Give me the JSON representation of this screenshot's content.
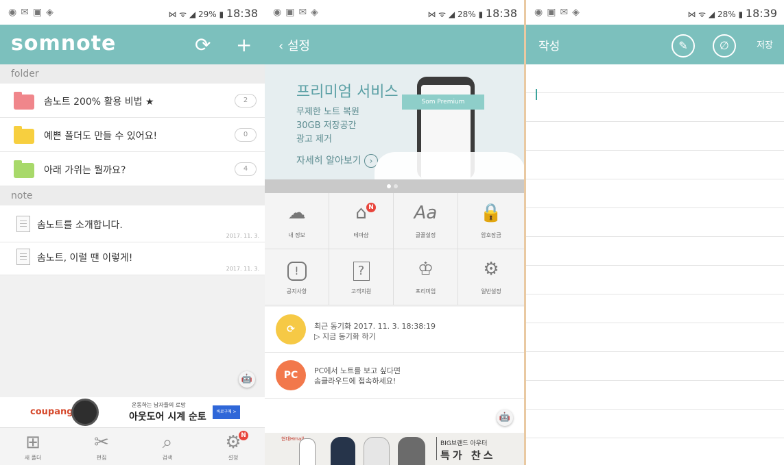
{
  "colors": {
    "teal": "#7cc0bd",
    "badge_red": "#e8453c",
    "folder_red": "#f0868b",
    "folder_yellow": "#f7cf3f",
    "folder_green": "#a8d96a",
    "sync_yellow": "#f6c945",
    "pc_orange": "#f2784b"
  },
  "statusbars": [
    {
      "battery": "29%",
      "time": "18:38"
    },
    {
      "battery": "28%",
      "time": "18:38"
    },
    {
      "battery": "28%",
      "time": "18:39"
    }
  ],
  "list_screen": {
    "logo": "somnote",
    "folder_header": "folder",
    "folders": [
      {
        "name": "솜노트 200% 활용 비법 ★",
        "count": "2"
      },
      {
        "name": "예쁜 폴더도 만들 수 있어요!",
        "count": "0"
      },
      {
        "name": "아래 가위는 뭘까요?",
        "count": "4"
      }
    ],
    "note_header": "note",
    "notes": [
      {
        "title": "솜노트를 소개합니다.",
        "date": "2017. 11. 3."
      },
      {
        "title": "솜노트, 이럴 땐 이렇게!",
        "date": "2017. 11. 3."
      }
    ],
    "ad": {
      "brand": "coupang",
      "small": "운동하는 남자들의 로망",
      "big": "아웃도어 시계 순토",
      "button": "바로구매 >"
    },
    "bottom_nav": [
      {
        "label": "새 폴더",
        "icon": "new-folder-icon"
      },
      {
        "label": "편집",
        "icon": "scissors-icon"
      },
      {
        "label": "검색",
        "icon": "search-icon"
      },
      {
        "label": "설정",
        "icon": "gear-icon",
        "badge": "N"
      }
    ]
  },
  "settings_screen": {
    "back_title": "설정",
    "banner": {
      "title": "프리미엄 서비스",
      "line1": "무제한 노트 복원",
      "line2": "30GB 저장공간",
      "line3": "광고 제거",
      "more": "자세히 알아보기",
      "ribbon": "Som Premium"
    },
    "grid": [
      {
        "label": "내 정보",
        "icon": "cloud-icon"
      },
      {
        "label": "테마샵",
        "icon": "shop-icon",
        "badge": "N"
      },
      {
        "label": "글꼴설정",
        "icon": "font-icon",
        "glyph": "Aa"
      },
      {
        "label": "암호잠금",
        "icon": "lock-icon"
      },
      {
        "label": "공지사항",
        "icon": "notice-icon",
        "glyph": "!"
      },
      {
        "label": "고객지원",
        "icon": "help-icon",
        "glyph": "?"
      },
      {
        "label": "프리미엄",
        "icon": "premium-icon"
      },
      {
        "label": "일반설정",
        "icon": "settings-gear-icon"
      }
    ],
    "sync": {
      "line1": "최근 동기화 2017. 11. 3. 18:38:19",
      "line2": "▷ 지금 동기화 하기"
    },
    "pc": {
      "badge": "PC",
      "line1": "PC에서 노트를 보고 싶다면",
      "line2": "솜클라우드에 접속하세요!"
    },
    "ad": {
      "brand": "현대Hmall",
      "line1": "BIG브랜드 아우터",
      "line2": "특가 찬스"
    }
  },
  "write_screen": {
    "title": "작성",
    "save": "저장"
  }
}
